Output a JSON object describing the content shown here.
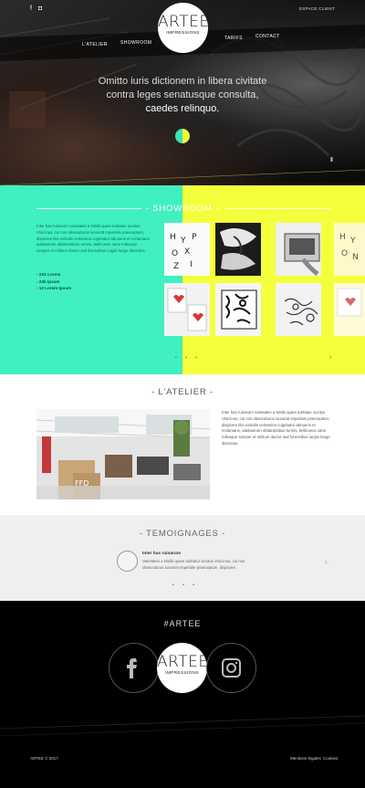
{
  "header": {
    "espace_client": "ESPACE CLIENT",
    "nav": [
      "L'ATELIER",
      "SHOWROOM",
      "TARIFS",
      "CONTACT"
    ],
    "logo": {
      "name": "ARTEE",
      "sub": "IMPRESSIONS"
    },
    "social": {
      "facebook": "f",
      "instagram": "◘"
    }
  },
  "hero": {
    "line1": "Omitto iuris dictionem in libera civitate",
    "line2": "contra leges senatusque consulta,",
    "line3": "caedes relinquo.",
    "pause": "II"
  },
  "showroom": {
    "title": "- SHOWROOM -",
    "paragraph": "Inter has ruinarum varietates a Nisibi quam tuebatur accitus Vrsicinus, cui nos obsecuturos iunxerat imperiale praeceptum, dispicere litis exitialis certamina cogebatur abnuens et reclamans, adulatorum oblatrantibus turmis, bellicosus sane milesque semper et militum ductor sed forensibus iurgiis longe discretus.",
    "list": [
      "- 2X1 Lorem",
      "- 24h Ipsum",
      "- 12 Lorem Ipsum"
    ],
    "dots": "• • •",
    "arrow": "›"
  },
  "atelier": {
    "title": "- L'ATELIER -",
    "paragraph": "Inter has ruinarum varietates a Nisibi quam tuebatur accitus Vrsicinus, cui nos obsecuturos iunxerat imperiale praeceptum, dispicere litis exitialis certamina cogebatur abnuens et reclamans, adulatorum oblatrantibus turmis, bellicosus sane milesque semper et militum ductor sed forensibus iurgiis longe discretus.",
    "photo_label": "FFD"
  },
  "temoignages": {
    "title": "- TEMOIGNAGES -",
    "name": "Inter has ruinarum",
    "text": "Varietates a Nisibi quam tuebatur accitus Vrsicinus, cui nos obsecuturos iunxerat imperiale praeceptum, dispicere.",
    "dots": "• • •",
    "arrow": "›"
  },
  "footer": {
    "hashtag": "#ARTEE",
    "copyright": "ARTEE © 2017",
    "links": [
      "Mentions légales",
      "Cookies"
    ],
    "facebook": "f"
  },
  "colors": {
    "mint": "#41f0c0",
    "yellow": "#f4ff3c",
    "dark": "#000000",
    "light_gray": "#efefef"
  }
}
